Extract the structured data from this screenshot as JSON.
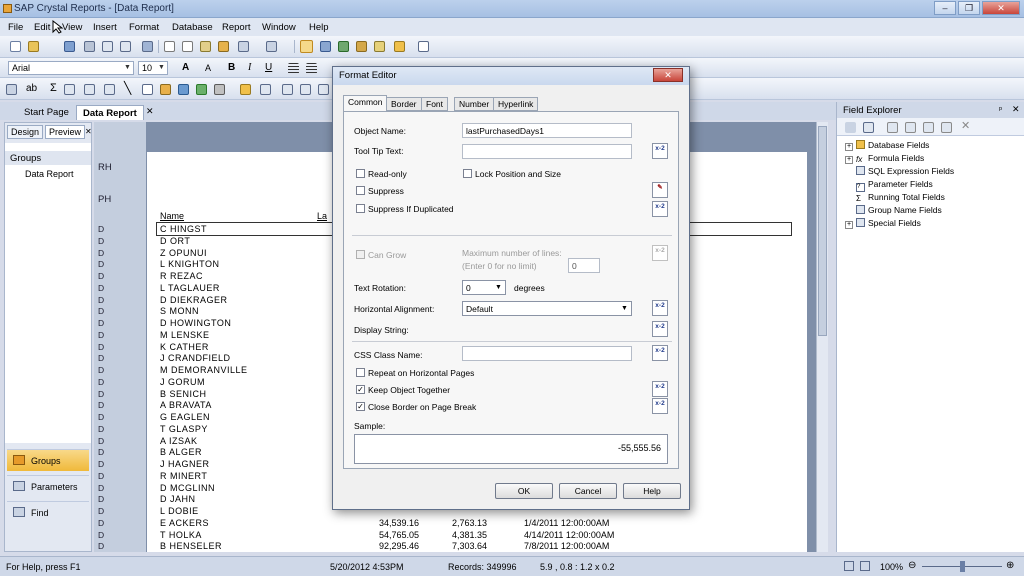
{
  "window": {
    "title": "SAP Crystal Reports - [Data Report]"
  },
  "menu": [
    "File",
    "Edit",
    "View",
    "Insert",
    "Format",
    "Database",
    "Report",
    "Window",
    "Help"
  ],
  "font_toolbar": {
    "font": "Arial",
    "size": "10"
  },
  "doc_tabs": [
    "Start Page",
    "Data Report"
  ],
  "left_panel": {
    "tabs": [
      "Design",
      "Preview"
    ],
    "header": "Groups",
    "tree_item": "Data Report",
    "nav": [
      "Groups",
      "Parameters",
      "Find"
    ]
  },
  "report": {
    "sections": [
      "RH",
      "PH"
    ],
    "col_header_name": "Name",
    "col_header_partial": "La",
    "detail_marker": "D",
    "names": [
      "C HINGST",
      "D ORT",
      "Z OPUNUI",
      "L KNIGHTON",
      "R REZAC",
      "L TAGLAUER",
      "D DIEKRAGER",
      "S MONN",
      "D HOWINGTON",
      "M LENSKE",
      "K CATHER",
      "J CRANDFIELD",
      "M DEMORANVILLE",
      "J GORUM",
      "B SENICH",
      "A BRAVATA",
      "G EAGLEN",
      "T GLASPY",
      "A IZSAK",
      "B ALGER",
      "J HAGNER",
      "R MINERT",
      "D MCGLINN",
      "D JAHN",
      "L DOBIE",
      "E ACKERS",
      "T HOLKA",
      "B HENSELER"
    ],
    "bottom_rows": [
      {
        "amount": "34,539.16",
        "small": "2,763.13",
        "date": "1/4/2011  12:00:00AM"
      },
      {
        "amount": "54,765.05",
        "small": "4,381.35",
        "date": "4/14/2011  12:00:00AM"
      },
      {
        "amount": "92,295.46",
        "small": "7,303.64",
        "date": "7/8/2011  12:00:00AM"
      }
    ]
  },
  "field_explorer": {
    "title": "Field Explorer",
    "items": [
      "Database Fields",
      "Formula Fields",
      "SQL Expression Fields",
      "Parameter Fields",
      "Running Total Fields",
      "Group Name Fields",
      "Special Fields"
    ]
  },
  "status": {
    "help": "For Help, press F1",
    "date": "5/20/2012  4:53PM",
    "records": "Records:  349996",
    "coords": "5.9 , 0.8 : 1.2 x 0.2",
    "zoom": "100%"
  },
  "dialog": {
    "title": "Format Editor",
    "tabs": [
      "Common",
      "Border",
      "Font",
      "Number",
      "Hyperlink"
    ],
    "object_name_label": "Object Name:",
    "object_name_value": "lastPurchasedDays1",
    "tooltip_label": "Tool Tip Text:",
    "read_only": "Read-only",
    "lock_position": "Lock Position and Size",
    "suppress": "Suppress",
    "suppress_dup": "Suppress If Duplicated",
    "can_grow": "Can Grow",
    "max_lines_label": "Maximum number of lines:",
    "max_lines_hint": "(Enter 0 for no limit)",
    "max_lines_value": "0",
    "text_rotation_label": "Text Rotation:",
    "text_rotation_value": "0",
    "degrees": "degrees",
    "horiz_align_label": "Horizontal Alignment:",
    "horiz_align_value": "Default",
    "display_string_label": "Display String:",
    "css_label": "CSS Class Name:",
    "repeat_horiz": "Repeat on Horizontal Pages",
    "keep_together": "Keep Object Together",
    "close_border": "Close Border on Page Break",
    "sample_label": "Sample:",
    "sample_value": "-55,555.56",
    "ok": "OK",
    "cancel": "Cancel",
    "help": "Help",
    "formula_btn": "x-2"
  }
}
